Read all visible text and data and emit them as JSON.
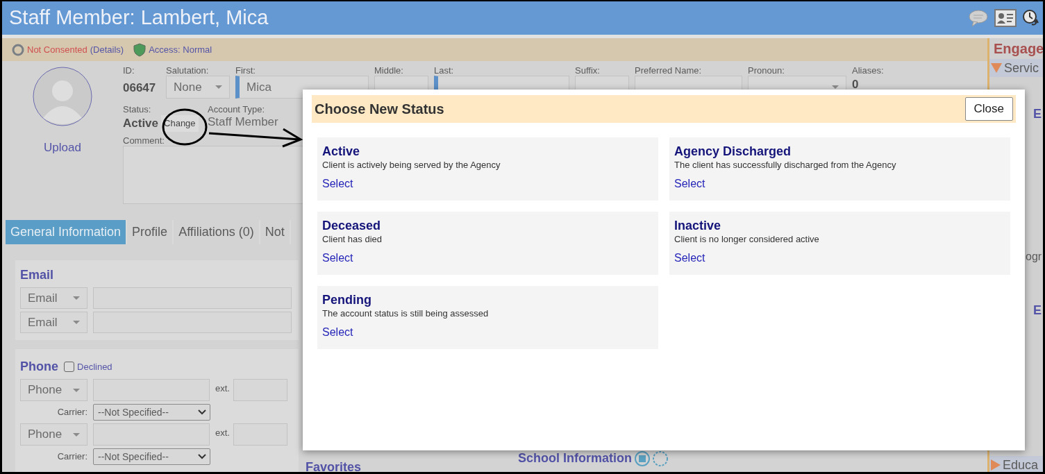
{
  "header": {
    "title": "Staff Member: Lambert, Mica"
  },
  "consent_bar": {
    "consent": "Not Consented",
    "details_link": "(Details)",
    "access": "Access: Normal"
  },
  "profile": {
    "upload_link": "Upload",
    "id_label": "ID:",
    "id": "06647",
    "fields": [
      {
        "label": "Salutation:",
        "kind": "select",
        "value": "None"
      },
      {
        "label": "First:",
        "kind": "input",
        "value": "Mica",
        "required": true
      },
      {
        "label": "Middle:",
        "kind": "input"
      },
      {
        "label": "Last:",
        "kind": "input",
        "required": true
      },
      {
        "label": "Suffix:",
        "kind": "input"
      },
      {
        "label": "Preferred Name:",
        "kind": "input"
      },
      {
        "label": "Pronoun:",
        "kind": "select"
      },
      {
        "label": "Aliases:",
        "kind": "text",
        "value": "0"
      }
    ],
    "status_label": "Status:",
    "status": "Active",
    "change_button": "Change",
    "account_type_label": "Account Type:",
    "account_type": "Staff Member",
    "comment_label": "Comment:"
  },
  "tabs": [
    {
      "label": "General Information",
      "selected": true
    },
    {
      "label": "Profile",
      "selected": false
    },
    {
      "label": "Affiliations (0)",
      "selected": false
    },
    {
      "label": "Not",
      "selected": false
    }
  ],
  "email": {
    "title": "Email",
    "rows": [
      {
        "type": "Email"
      },
      {
        "type": "Email"
      }
    ]
  },
  "phone": {
    "title": "Phone",
    "declined_label": "Declined",
    "declined": false,
    "rows": [
      {
        "type": "Phone",
        "ext_label": "ext.",
        "carrier_label": "Carrier:",
        "carrier": "--Not Specified--"
      },
      {
        "type": "Phone",
        "ext_label": "ext.",
        "carrier_label": "Carrier:",
        "carrier": "--Not Specified--"
      }
    ]
  },
  "favorites": {
    "title": "Favorites"
  },
  "school": {
    "title": "School Information"
  },
  "right_panel": {
    "title": "Engage",
    "section": "Servic",
    "fragments": [
      "E",
      "ogr",
      "E"
    ],
    "bottom_section": "Educa"
  },
  "modal": {
    "title": "Choose New Status",
    "close": "Close",
    "options": [
      {
        "name": "Active",
        "description": "Client is actively being served by the Agency",
        "action": "Select"
      },
      {
        "name": "Agency Discharged",
        "description": "The client has successfully discharged from the Agency",
        "action": "Select"
      },
      {
        "name": "Deceased",
        "description": "Client has died",
        "action": "Select"
      },
      {
        "name": "Inactive",
        "description": "Client is no longer considered active",
        "action": "Select"
      },
      {
        "name": "Pending",
        "description": "The account status is still being assessed",
        "action": "Select"
      }
    ]
  }
}
